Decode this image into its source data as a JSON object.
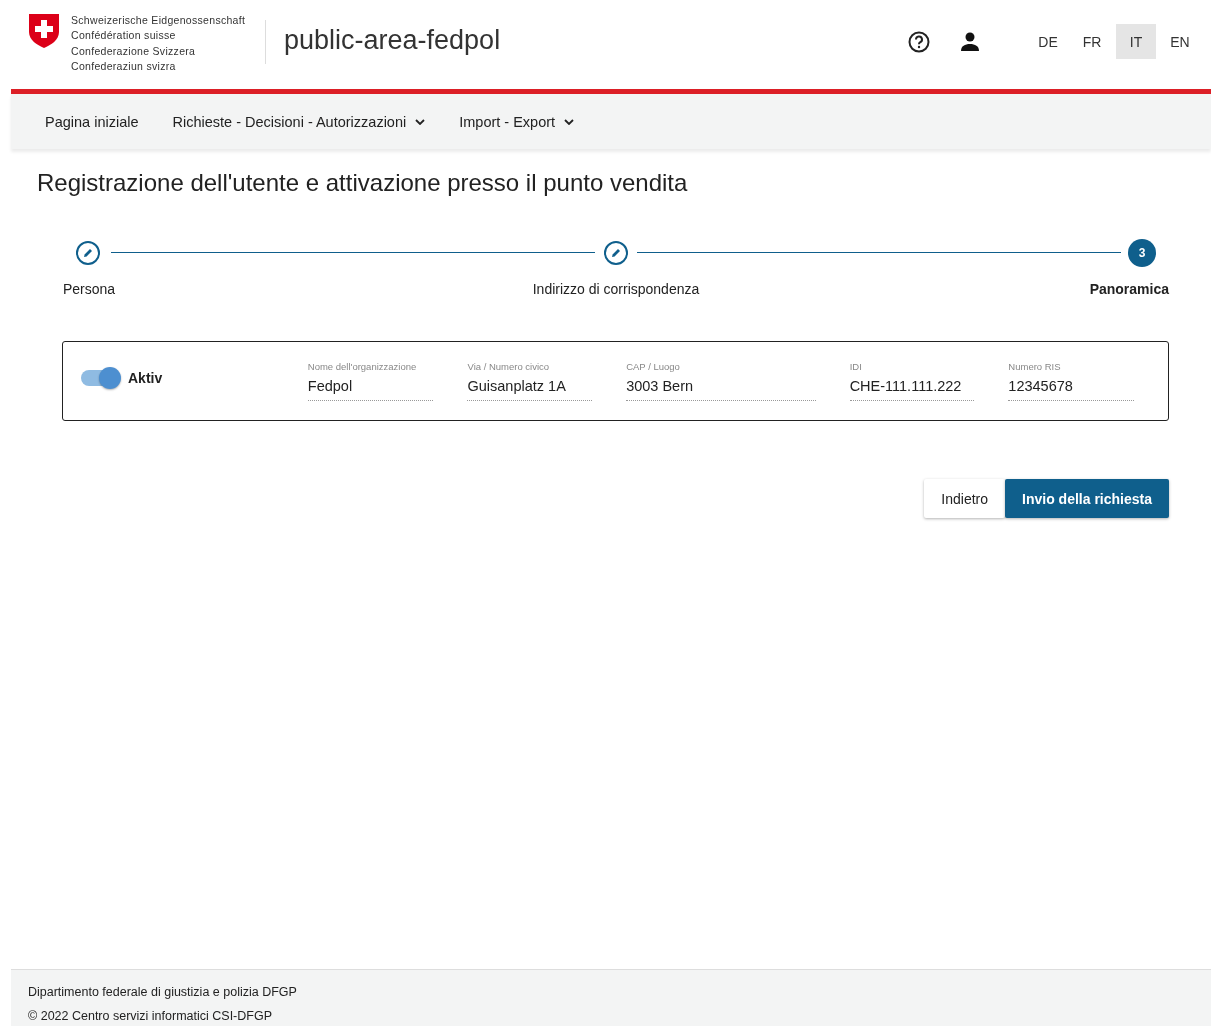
{
  "header": {
    "confederation": [
      "Schweizerische Eidgenossenschaft",
      "Confédération suisse",
      "Confederazione Svizzera",
      "Confederaziun svizra"
    ],
    "app_title": "public-area-fedpol",
    "languages": [
      {
        "label": "DE",
        "selected": false
      },
      {
        "label": "FR",
        "selected": false
      },
      {
        "label": "IT",
        "selected": true
      },
      {
        "label": "EN",
        "selected": false
      }
    ]
  },
  "nav": [
    {
      "label": "Pagina iniziale",
      "dropdown": false
    },
    {
      "label": "Richieste - Decisioni - Autorizzazioni",
      "dropdown": true
    },
    {
      "label": "Import - Export",
      "dropdown": true
    }
  ],
  "page_title": "Registrazione dell'utente e attivazione presso il punto vendita",
  "steps": [
    {
      "label": "Persona",
      "kind": "done"
    },
    {
      "label": "Indirizzo di corrispondenza",
      "kind": "done"
    },
    {
      "label": "Panoramica",
      "kind": "current",
      "number": "3"
    }
  ],
  "summary": {
    "toggle": {
      "label": "Aktiv",
      "on": true
    },
    "fields": [
      {
        "label": "Nome dell'organizzazione",
        "value": "Fedpol"
      },
      {
        "label": "Via / Numero civico",
        "value": "Guisanplatz 1A"
      },
      {
        "label": "CAP / Luogo",
        "value": "3003 Bern"
      },
      {
        "label": "IDI",
        "value": "CHE-111.111.222"
      },
      {
        "label": "Numero RIS",
        "value": "12345678"
      }
    ]
  },
  "buttons": [
    {
      "label": "Indietro",
      "kind": "secondary"
    },
    {
      "label": "Invio della richiesta",
      "kind": "primary"
    }
  ],
  "footer": [
    "Dipartimento federale di giustizia e polizia DFGP",
    "© 2022 Centro servizi informatici CSI-DFGP"
  ]
}
